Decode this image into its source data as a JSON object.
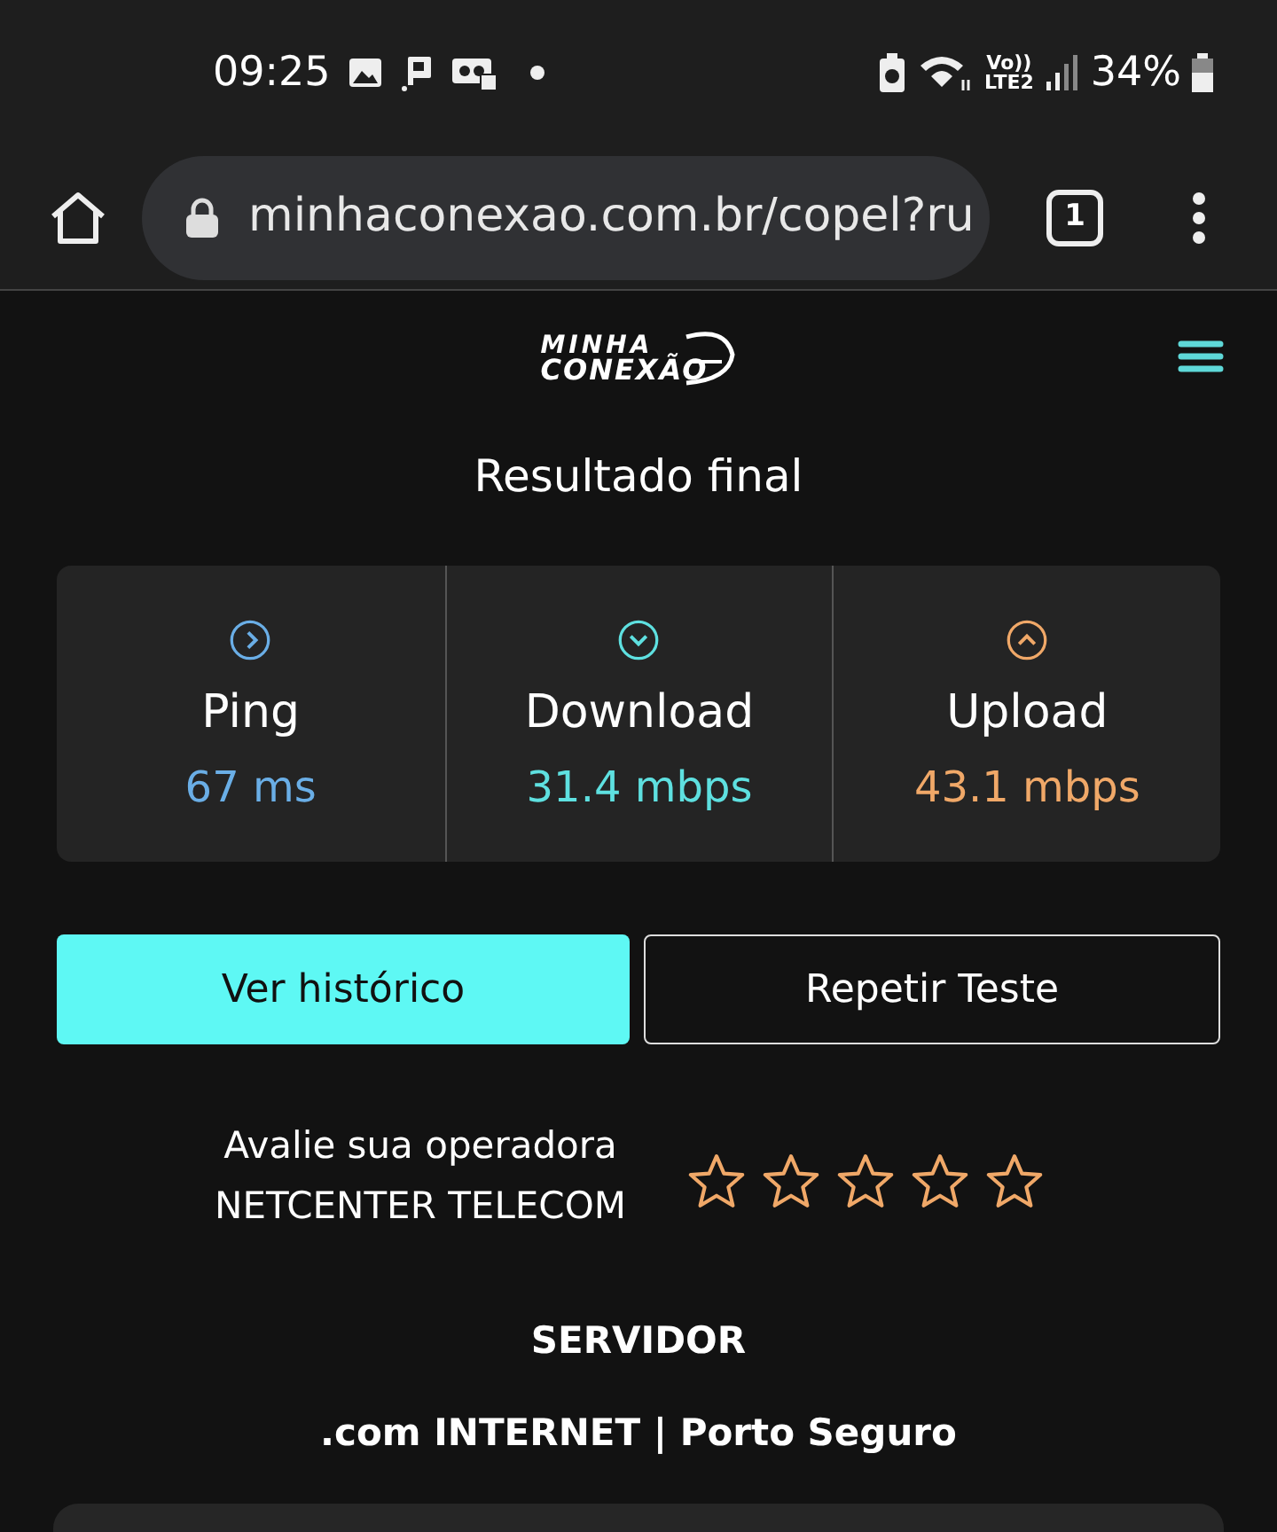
{
  "status_bar": {
    "time": "09:25",
    "network": "Vo))\nLTE2",
    "battery": "34%"
  },
  "browser": {
    "url": "minhaconexao.com.br/copel?ru",
    "tab_count": "1"
  },
  "header": {
    "logo_line1": "MINHA",
    "logo_line2": "CONEXÃO"
  },
  "title": "Resultado final",
  "metrics": [
    {
      "kind": "ping",
      "label": "Ping",
      "value": "67 ms",
      "color": "#6aaee6"
    },
    {
      "kind": "download",
      "label": "Download",
      "value": "31.4 mbps",
      "color": "#5ee0e0"
    },
    {
      "kind": "upload",
      "label": "Upload",
      "value": "43.1 mbps",
      "color": "#f0a868"
    }
  ],
  "buttons": [
    {
      "label": "Ver histórico",
      "primary": true
    },
    {
      "label": "Repetir Teste",
      "primary": false
    }
  ],
  "rating": {
    "prompt": "Avalie sua operadora",
    "operator": "NETCENTER TELECOM",
    "stars": 0
  },
  "server": {
    "heading": "SERVIDOR",
    "name": ".com INTERNET | Porto Seguro"
  }
}
